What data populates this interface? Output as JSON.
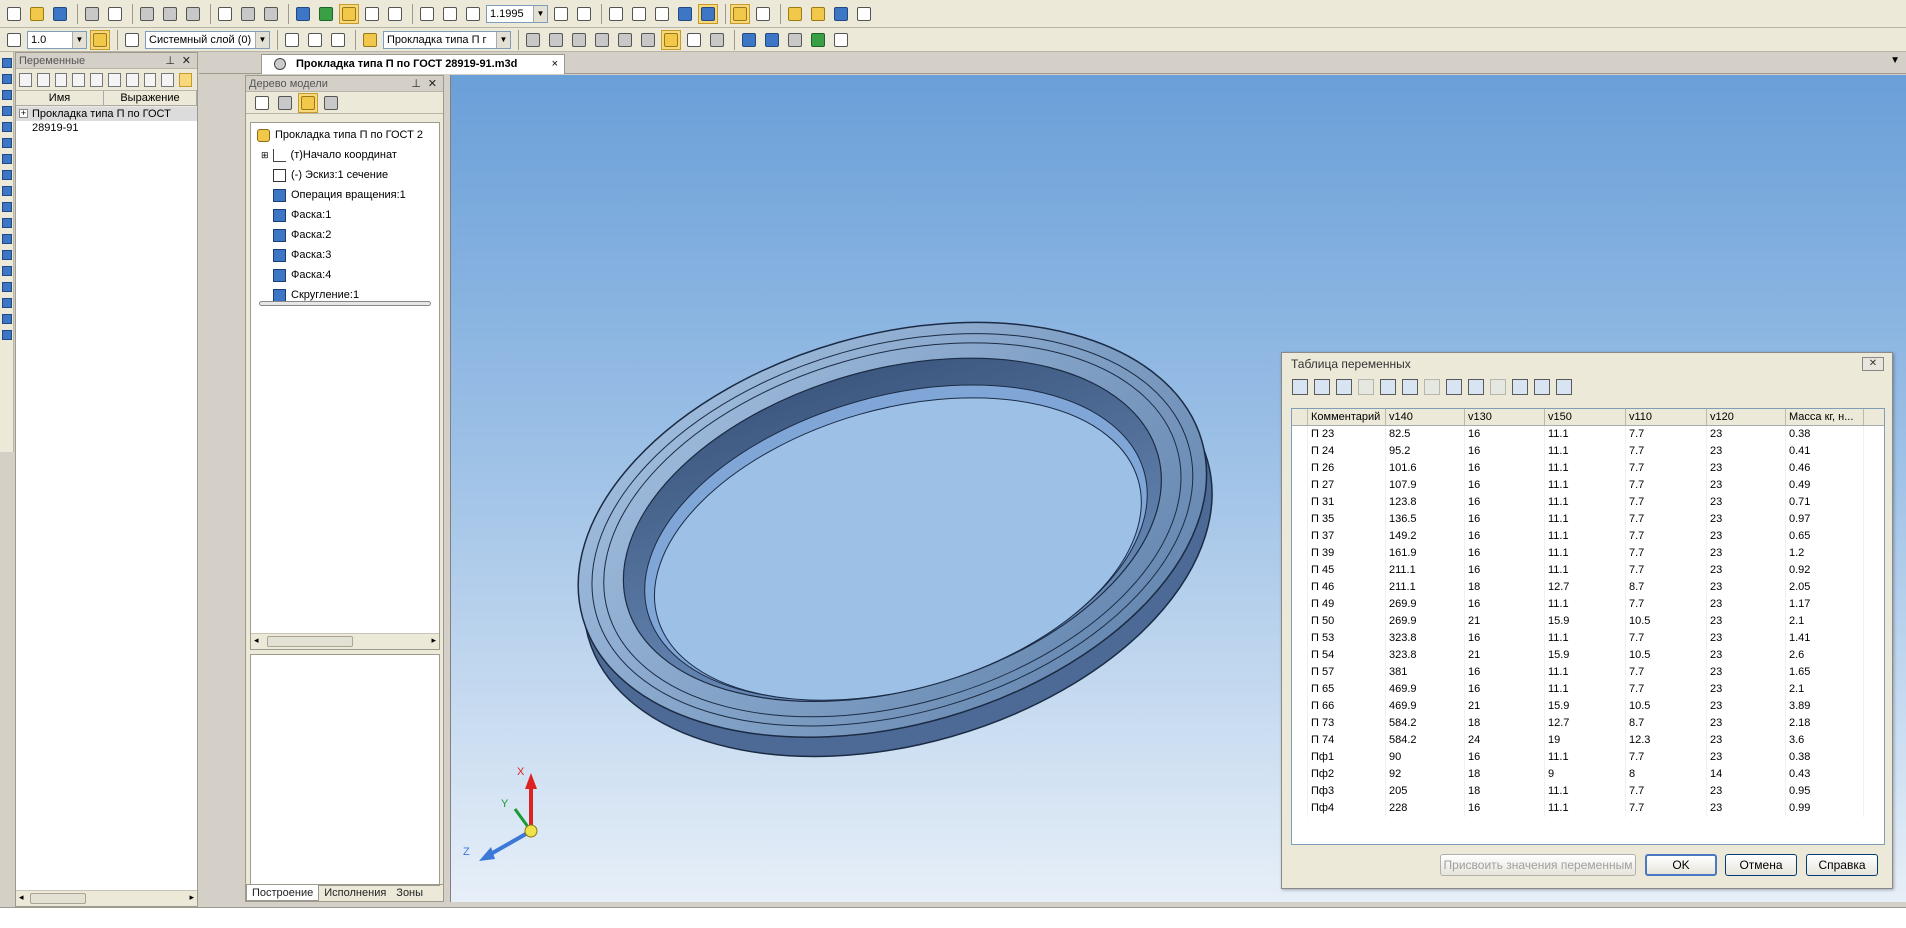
{
  "toolbar": {
    "scale_value": "1.0",
    "zoom_value": "1.1995",
    "layer_value": "Системный слой (0)",
    "document_combo_value": "Прокладка типа П г"
  },
  "variables_panel": {
    "title": "Переменные",
    "columns": [
      "Имя",
      "Выражение"
    ],
    "rows": [
      {
        "label": "Прокладка типа П по ГОСТ 28919-91"
      }
    ]
  },
  "document_tab": {
    "label": "Прокладка типа П по ГОСТ 28919-91.m3d",
    "close": "×"
  },
  "model_tree": {
    "title": "Дерево модели",
    "items": [
      {
        "label": "Прокладка типа П по ГОСТ 2",
        "icon": "part-icon"
      },
      {
        "label": "(т)Начало координат",
        "icon": "axis-icon"
      },
      {
        "label": "(-) Эскиз:1   сечение",
        "icon": "sketch-icon"
      },
      {
        "label": "Операция вращения:1",
        "icon": "revolve-icon"
      },
      {
        "label": "Фаска:1",
        "icon": "chamfer-icon"
      },
      {
        "label": "Фаска:2",
        "icon": "chamfer-icon"
      },
      {
        "label": "Фаска:3",
        "icon": "chamfer-icon"
      },
      {
        "label": "Фаска:4",
        "icon": "chamfer-icon"
      },
      {
        "label": "Скругление:1",
        "icon": "fillet-icon"
      }
    ],
    "tabs": [
      "Построение",
      "Исполнения",
      "Зоны"
    ]
  },
  "axes": {
    "x": "X",
    "y": "Y",
    "z": "Z"
  },
  "variables_dialog": {
    "title": "Таблица переменных",
    "columns": [
      "Комментарий",
      "v140",
      "v130",
      "v150",
      "v110",
      "v120",
      "Масса кг, н..."
    ],
    "rows": [
      [
        "П 23",
        "82.5",
        "16",
        "11.1",
        "7.7",
        "23",
        "0.38"
      ],
      [
        "П 24",
        "95.2",
        "16",
        "11.1",
        "7.7",
        "23",
        "0.41"
      ],
      [
        "П 26",
        "101.6",
        "16",
        "11.1",
        "7.7",
        "23",
        "0.46"
      ],
      [
        "П 27",
        "107.9",
        "16",
        "11.1",
        "7.7",
        "23",
        "0.49"
      ],
      [
        "П 31",
        "123.8",
        "16",
        "11.1",
        "7.7",
        "23",
        "0.71"
      ],
      [
        "П 35",
        "136.5",
        "16",
        "11.1",
        "7.7",
        "23",
        "0.97"
      ],
      [
        "П 37",
        "149.2",
        "16",
        "11.1",
        "7.7",
        "23",
        "0.65"
      ],
      [
        "П 39",
        "161.9",
        "16",
        "11.1",
        "7.7",
        "23",
        "1.2"
      ],
      [
        "П 45",
        "211.1",
        "16",
        "11.1",
        "7.7",
        "23",
        "0.92"
      ],
      [
        "П 46",
        "211.1",
        "18",
        "12.7",
        "8.7",
        "23",
        "2.05"
      ],
      [
        "П 49",
        "269.9",
        "16",
        "11.1",
        "7.7",
        "23",
        "1.17"
      ],
      [
        "П 50",
        "269.9",
        "21",
        "15.9",
        "10.5",
        "23",
        "2.1"
      ],
      [
        "П 53",
        "323.8",
        "16",
        "11.1",
        "7.7",
        "23",
        "1.41"
      ],
      [
        "П 54",
        "323.8",
        "21",
        "15.9",
        "10.5",
        "23",
        "2.6"
      ],
      [
        "П 57",
        "381",
        "16",
        "11.1",
        "7.7",
        "23",
        "1.65"
      ],
      [
        "П 65",
        "469.9",
        "16",
        "11.1",
        "7.7",
        "23",
        "2.1"
      ],
      [
        "П 66",
        "469.9",
        "21",
        "15.9",
        "10.5",
        "23",
        "3.89"
      ],
      [
        "П 73",
        "584.2",
        "18",
        "12.7",
        "8.7",
        "23",
        "2.18"
      ],
      [
        "П 74",
        "584.2",
        "24",
        "19",
        "12.3",
        "23",
        "3.6"
      ],
      [
        "Пф1",
        "90",
        "16",
        "11.1",
        "7.7",
        "23",
        "0.38"
      ],
      [
        "Пф2",
        "92",
        "18",
        "9",
        "8",
        "14",
        "0.43"
      ],
      [
        "Пф3",
        "205",
        "18",
        "11.1",
        "7.7",
        "23",
        "0.95"
      ],
      [
        "Пф4",
        "228",
        "16",
        "11.1",
        "7.7",
        "23",
        "0.99"
      ]
    ],
    "buttons": {
      "assign": "Присвоить значения переменным",
      "ok": "OK",
      "cancel": "Отмена",
      "help": "Справка"
    }
  },
  "colors": {
    "part_blue": "#5f86b7",
    "bg_top": "#6a9fd8",
    "bg_bottom": "#e7eff8"
  }
}
